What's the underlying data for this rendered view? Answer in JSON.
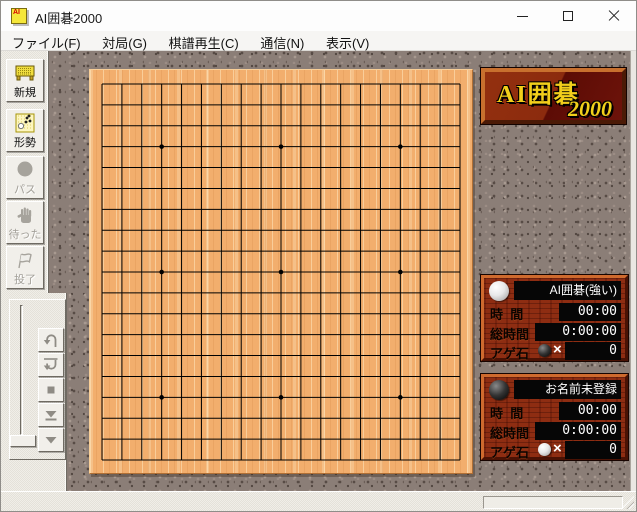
{
  "window": {
    "title": "AI囲碁2000",
    "icon_text": "AI",
    "icons": {
      "minimize": "window-minimize-icon",
      "maximize": "window-maximize-icon",
      "close": "window-close-icon"
    }
  },
  "menu_bar": {
    "items": [
      {
        "label": "ファイル(F)"
      },
      {
        "label": "対局(G)"
      },
      {
        "label": "棋譜再生(C)"
      },
      {
        "label": "通信(N)"
      },
      {
        "label": "表示(V)"
      }
    ]
  },
  "toolbar": {
    "buttons": [
      {
        "label": "新規",
        "icon": "new-game-table-icon",
        "enabled": true
      },
      {
        "label": "形勢",
        "icon": "territory-eval-icon",
        "enabled": true
      },
      {
        "label": "パス",
        "icon": "pass-stone-icon",
        "enabled": false
      },
      {
        "label": "待った",
        "icon": "undo-hand-icon",
        "enabled": false
      },
      {
        "label": "投了",
        "icon": "resign-flag-icon",
        "enabled": false
      }
    ]
  },
  "replay_controls": {
    "slider": {
      "orientation": "vertical",
      "thumb_position": "bottom"
    },
    "buttons": [
      {
        "icon": "jump-back-icon",
        "enabled": false
      },
      {
        "icon": "jump-forward-icon",
        "enabled": false
      },
      {
        "icon": "stop-icon",
        "enabled": false
      },
      {
        "icon": "skip-to-end-icon",
        "enabled": false
      },
      {
        "icon": "step-forward-icon",
        "enabled": false
      }
    ]
  },
  "board": {
    "size": 19,
    "star_points": [
      [
        3,
        3
      ],
      [
        9,
        3
      ],
      [
        15,
        3
      ],
      [
        3,
        9
      ],
      [
        9,
        9
      ],
      [
        15,
        9
      ],
      [
        3,
        15
      ],
      [
        9,
        15
      ],
      [
        15,
        15
      ]
    ],
    "wood_color": "#f2ae6d",
    "line_color": "#000000"
  },
  "logo": {
    "title": "AI囲碁",
    "year": "2000",
    "text_color": "#f2cf1b",
    "bg_colors": [
      "#8e2c10",
      "#5c0b05"
    ]
  },
  "players": [
    {
      "stone": "white",
      "name": "AI囲碁(強い)",
      "time_label": "時  間",
      "time_value": "00:00",
      "total_time_label": "総時間",
      "total_time_value": "0:00:00",
      "captures_label": "アゲ石",
      "captures_stone": "black",
      "captures_x": "×",
      "captures_value": "0"
    },
    {
      "stone": "black",
      "name": "お名前未登録",
      "time_label": "時  間",
      "time_value": "00:00",
      "total_time_label": "総時間",
      "total_time_value": "0:00:00",
      "captures_label": "アゲ石",
      "captures_stone": "white",
      "captures_x": "×",
      "captures_value": "0"
    }
  ],
  "status_bar": {
    "field_text": ""
  }
}
